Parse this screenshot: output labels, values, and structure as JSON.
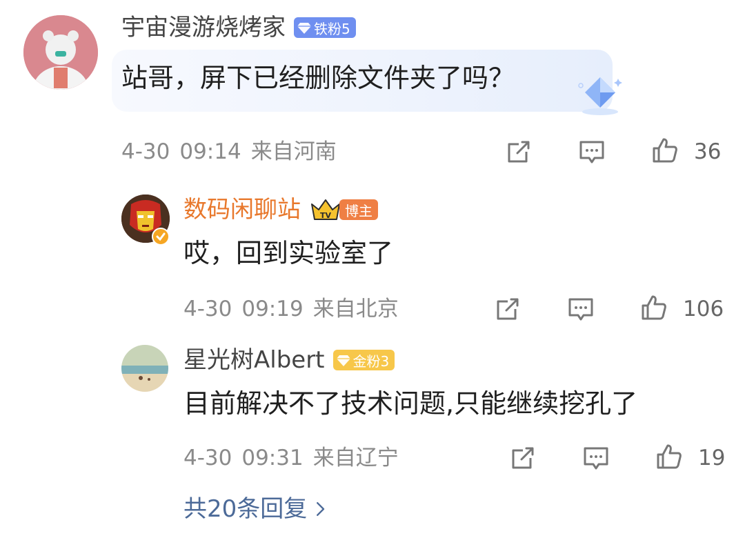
{
  "comments": [
    {
      "username": "宇宙漫游烧烤家",
      "badge": "铁粉5",
      "content": "站哥，屏下已经删除文件夹了吗？",
      "date": "4-30",
      "time": "09:14",
      "location": "来自河南",
      "likes": "36",
      "icons": [
        "share-icon",
        "comment-icon",
        "thumb-up-icon"
      ]
    },
    {
      "username": "数码闲聊站",
      "badge": "博主",
      "badge_crown_text": "TV",
      "content": "哎，回到实验室了",
      "date": "4-30",
      "time": "09:19",
      "location": "来自北京",
      "likes": "106"
    },
    {
      "username": "星光树Albert",
      "badge": "金粉3",
      "content": "目前解决不了技术问题,只能继续挖孔了",
      "date": "4-30",
      "time": "09:31",
      "location": "来自辽宁",
      "likes": "19"
    }
  ],
  "more_replies": "共20条回复",
  "colors": {
    "iron_badge": "#6f8ff0",
    "gold_badge": "#f7c74a",
    "blogger_name": "#e8782c",
    "blogger_badge": "#ef7f44",
    "link": "#4c6a98"
  }
}
